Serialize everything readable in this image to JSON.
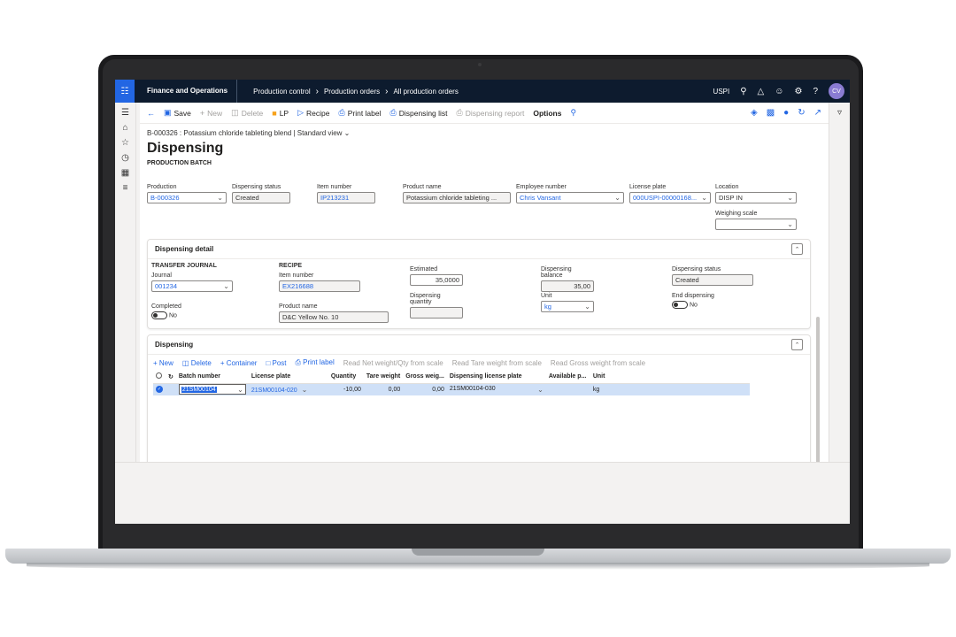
{
  "topbar": {
    "app_name": "Finance and Operations",
    "breadcrumbs": [
      "Production control",
      "Production orders",
      "All production orders"
    ],
    "company": "USPI",
    "avatar": "CV"
  },
  "actions": {
    "save": "Save",
    "new": "New",
    "delete": "Delete",
    "lp": "LP",
    "recipe": "Recipe",
    "print_label": "Print label",
    "dispensing_list": "Dispensing list",
    "dispensing_report": "Dispensing report",
    "options": "Options"
  },
  "caption": "B-000326 : Potassium chloride tableting blend  |  Standard view",
  "title": "Dispensing",
  "section": "PRODUCTION BATCH",
  "header_fields": {
    "production": {
      "label": "Production",
      "value": "B-000326"
    },
    "dispensing_status": {
      "label": "Dispensing status",
      "value": "Created"
    },
    "item_number": {
      "label": "Item number",
      "value": "IP213231"
    },
    "product_name": {
      "label": "Product name",
      "value": "Potassium chloride tableting ..."
    },
    "employee_number": {
      "label": "Employee number",
      "value": "Chris Vansant"
    },
    "license_plate": {
      "label": "License plate",
      "value": "000USPI-00000168..."
    },
    "location": {
      "label": "Location",
      "value": "DISP IN"
    },
    "weighing_scale": {
      "label": "Weighing scale",
      "value": ""
    }
  },
  "detail": {
    "title": "Dispensing detail",
    "transfer_journal": "TRANSFER JOURNAL",
    "journal_label": "Journal",
    "journal_value": "001234",
    "completed_label": "Completed",
    "completed_value": "No",
    "recipe": "RECIPE",
    "item_label": "Item number",
    "item_value": "EX216688",
    "product_label": "Product name",
    "product_value": "D&C Yellow No. 10",
    "estimated_label": "Estimated",
    "estimated_value": "35,0000",
    "disp_qty_label": "Dispensing quantity",
    "disp_qty_value": "",
    "balance_label": "Dispensing balance",
    "balance_value": "35,00",
    "unit_label": "Unit",
    "unit_value": "kg",
    "status_label": "Dispensing status",
    "status_value": "Created",
    "end_label": "End dispensing",
    "end_value": "No"
  },
  "dispensing": {
    "title": "Dispensing",
    "toolbar": {
      "new": "New",
      "delete": "Delete",
      "container": "Container",
      "post": "Post",
      "print_label": "Print label",
      "read_net": "Read Net weight/Qty from scale",
      "read_tare": "Read Tare weight from scale",
      "read_gross": "Read Gross weight from scale"
    },
    "columns": [
      "Batch number",
      "License plate",
      "Quantity",
      "Tare weight",
      "Gross weig...",
      "Dispensing license plate",
      "Available p...",
      "Unit"
    ],
    "row": {
      "batch": "21SM00104",
      "license_plate": "21SM00104-020",
      "quantity": "-10,00",
      "tare": "0,00",
      "gross": "0,00",
      "disp_lp": "21SM00104-030",
      "available": "",
      "unit": "kg"
    }
  }
}
